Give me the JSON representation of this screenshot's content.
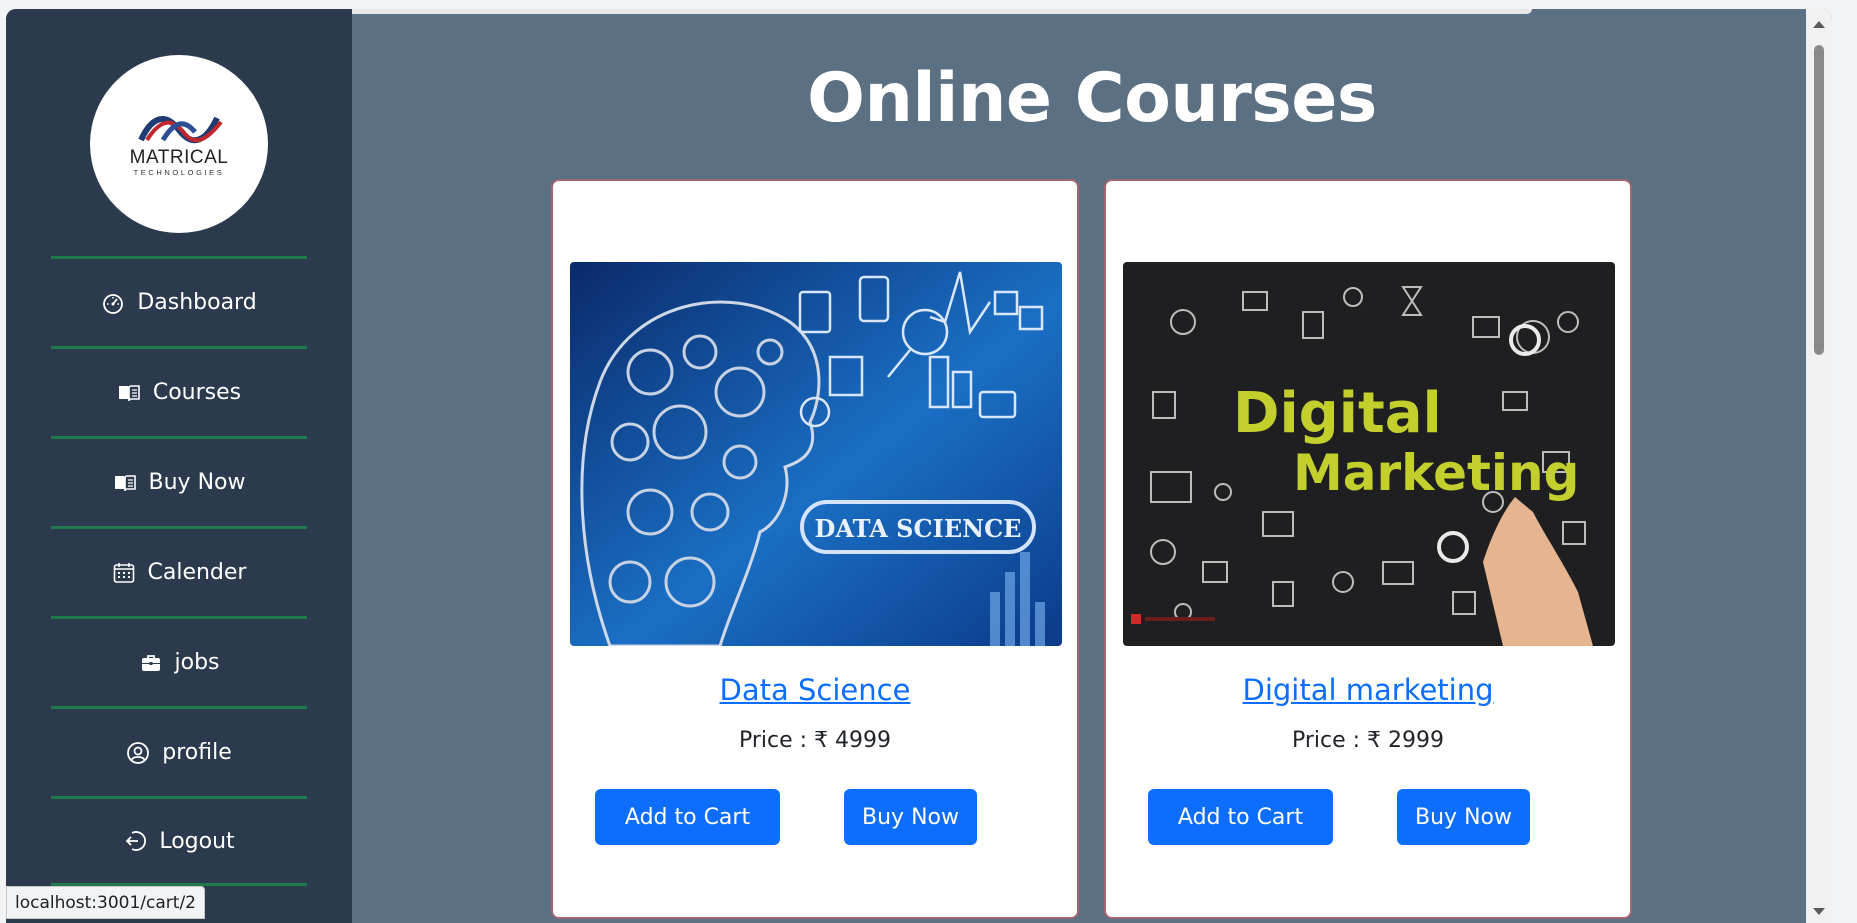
{
  "logo": {
    "line1": "MATRICAL",
    "line2": "TECHNOLOGIES"
  },
  "nav": [
    {
      "label": "Dashboard",
      "icon": "speedometer-icon"
    },
    {
      "label": "Courses",
      "icon": "book-icon"
    },
    {
      "label": "Buy Now",
      "icon": "book-icon"
    },
    {
      "label": "Calender",
      "icon": "calendar-icon"
    },
    {
      "label": "jobs",
      "icon": "briefcase-icon"
    },
    {
      "label": "profile",
      "icon": "user-circle-icon"
    },
    {
      "label": "Logout",
      "icon": "logout-icon"
    }
  ],
  "page": {
    "title": "Online Courses"
  },
  "courses": [
    {
      "name": "Data Science",
      "price": "Price : ₹ 4999",
      "image_text": "DATA SCIENCE",
      "add_to_cart": "Add to Cart",
      "buy_now": "Buy Now"
    },
    {
      "name": "Digital marketing",
      "price": "Price : ₹ 2999",
      "image_text_1": "Digital",
      "image_text_2": "Marketing",
      "add_to_cart": "Add to Cart",
      "buy_now": "Buy Now"
    }
  ],
  "status_bar": {
    "url": "localhost:3001/cart/2"
  },
  "colors": {
    "sidebar": "#2b3a4d",
    "main": "#5b7082",
    "accent": "#0d6efd",
    "divider": "#1e7b4a"
  }
}
